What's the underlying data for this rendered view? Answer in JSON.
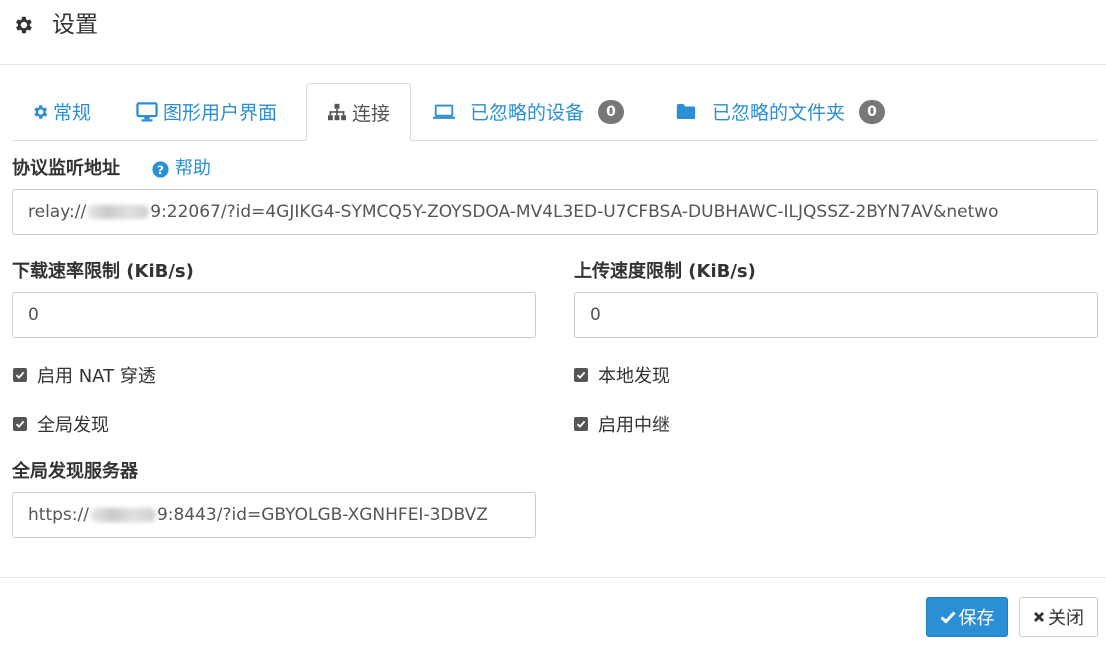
{
  "header": {
    "title": "设置",
    "icon": "gear-icon"
  },
  "tabs": [
    {
      "label": "常规",
      "icon": "cog-icon"
    },
    {
      "label": "图形用户界面",
      "icon": "desktop-icon"
    },
    {
      "label": "连接",
      "icon": "sitemap-icon",
      "active": true
    },
    {
      "label": "已忽略的设备",
      "icon": "laptop-icon",
      "badge": "0"
    },
    {
      "label": "已忽略的文件夹",
      "icon": "folder-icon",
      "badge": "0"
    }
  ],
  "listen": {
    "label": "协议监听地址",
    "help": "帮助",
    "value_prefix": "relay://",
    "value_suffix": "9:22067/?id=4GJIKG4-SYMCQ5Y-ZOYSDOA-MV4L3ED-U7CFBSA-DUBHAWC-ILJQSSZ-2BYN7AV&netwo"
  },
  "download": {
    "label": "下载速率限制 (KiB/s)",
    "value": "0"
  },
  "upload": {
    "label": "上传速度限制 (KiB/s)",
    "value": "0"
  },
  "checks": {
    "nat": "启用 NAT 穿透",
    "local": "本地发现",
    "global": "全局发现",
    "relay": "启用中继"
  },
  "discovery": {
    "label": "全局发现服务器",
    "value_prefix": "https://",
    "value_suffix": "9:8443/?id=GBYOLGB-XGNHFEI-3DBVZ"
  },
  "footer": {
    "save": "保存",
    "close": "关闭"
  },
  "colors": {
    "accent": "#2a8fd4",
    "badge": "#777777"
  }
}
